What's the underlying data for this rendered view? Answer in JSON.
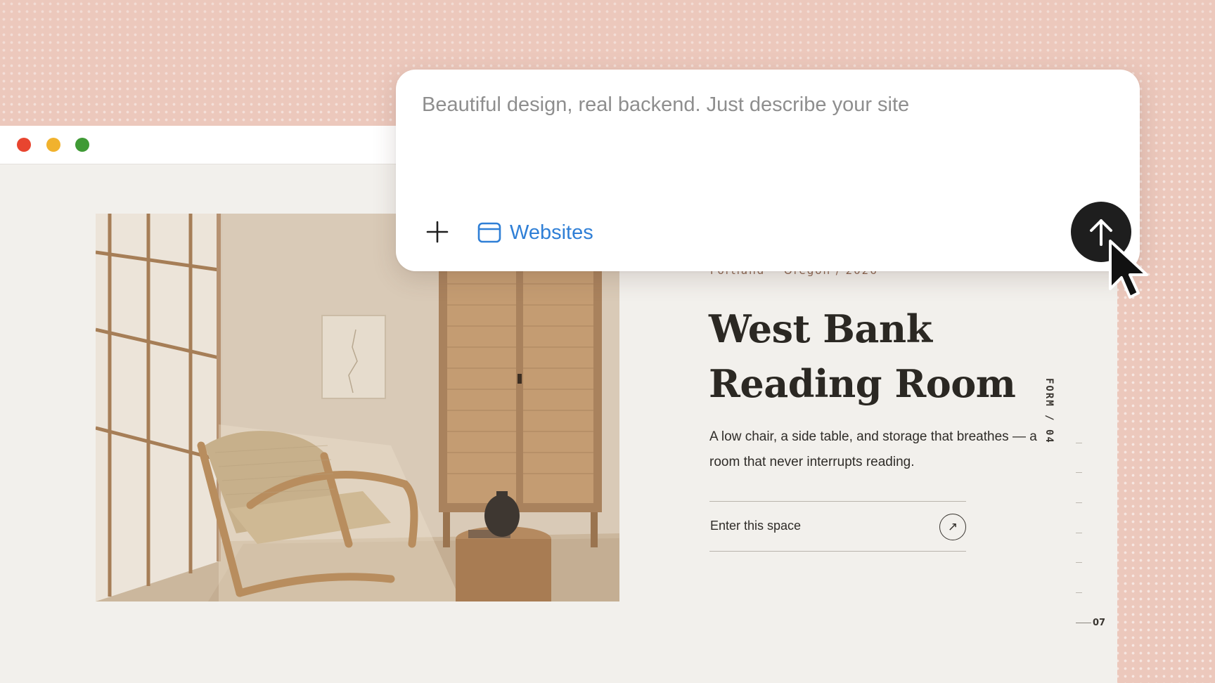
{
  "composer": {
    "placeholder": "Beautiful design, real backend. Just describe your site",
    "value": "",
    "chip_label": "Websites",
    "add_icon": "plus-icon",
    "chip_icon": "browser-window-icon",
    "send_icon": "arrow-up-icon",
    "chip_color": "#2f7fd6",
    "send_color": "#1e1e1e"
  },
  "page": {
    "eyebrow": {
      "city": "Portland",
      "separator": "·",
      "region_year": "Oregon / 2026"
    },
    "headline_line1": "West Bank",
    "headline_line2": "Reading Room",
    "description": "A low chair, a side table, and storage that breathes — a room that never interrupts reading.",
    "cta_label": "Enter this space",
    "cta_icon": "arrow-up-right-icon",
    "vertical_label": "FORM / 04",
    "page_number": "07"
  },
  "colors": {
    "background": "#ecc8bc",
    "page_background": "#f2f0ec",
    "traffic_red": "#e8452f",
    "traffic_yellow": "#f1b22d",
    "traffic_green": "#3f9a35",
    "text_dark": "#2b2823"
  }
}
